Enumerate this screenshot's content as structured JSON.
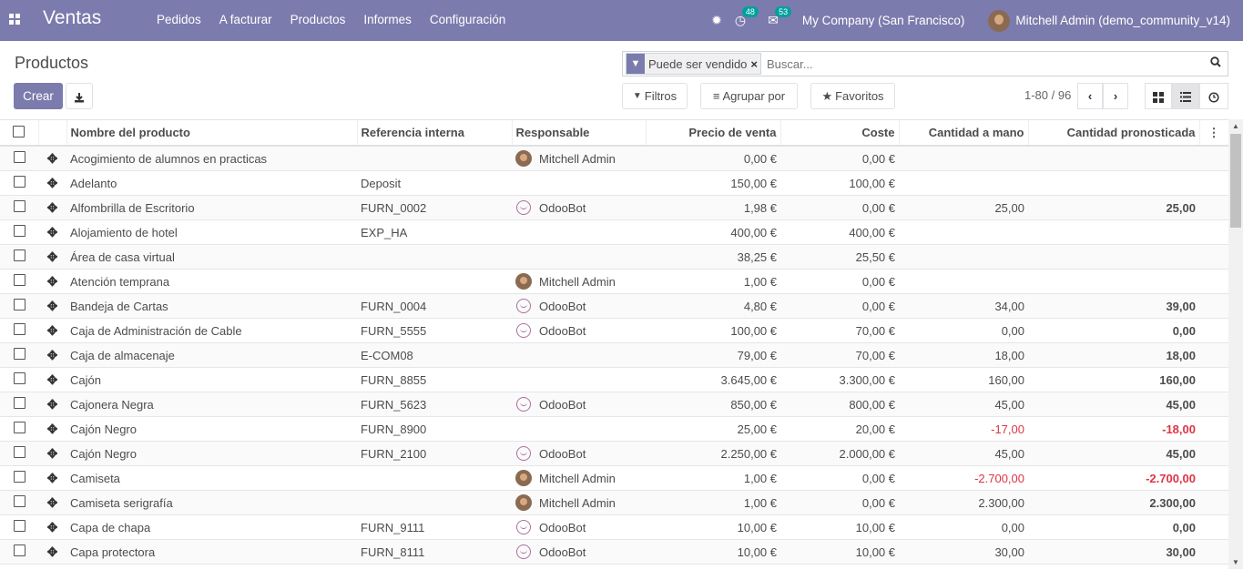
{
  "app": {
    "title": "Ventas",
    "menu": [
      "Pedidos",
      "A facturar",
      "Productos",
      "Informes",
      "Configuración"
    ],
    "activity_badge": "48",
    "messages_badge": "53",
    "company": "My Company (San Francisco)",
    "user": "Mitchell Admin (demo_community_v14)"
  },
  "control_panel": {
    "title": "Productos",
    "create_label": "Crear",
    "facet_label": "Puede ser vendido",
    "search_placeholder": "Buscar...",
    "filters_label": "Filtros",
    "group_by_label": "Agrupar por",
    "favorites_label": "Favoritos",
    "pager": "1-80 / 96"
  },
  "table": {
    "columns": [
      "Nombre del producto",
      "Referencia interna",
      "Responsable",
      "Precio de venta",
      "Coste",
      "Cantidad a mano",
      "Cantidad pronosticada"
    ],
    "rows": [
      {
        "name": "Acogimiento de alumnos en practicas",
        "ref": "",
        "resp": "Mitchell Admin",
        "resp_type": "mitchell",
        "price": "0,00 €",
        "cost": "0,00 €",
        "onhand": "",
        "forecast": "",
        "negative": false
      },
      {
        "name": "Adelanto",
        "ref": "Deposit",
        "resp": "",
        "resp_type": "",
        "price": "150,00 €",
        "cost": "100,00 €",
        "onhand": "",
        "forecast": "",
        "negative": false
      },
      {
        "name": "Alfombrilla de Escritorio",
        "ref": "FURN_0002",
        "resp": "OdooBot",
        "resp_type": "odoobot",
        "price": "1,98 €",
        "cost": "0,00 €",
        "onhand": "25,00",
        "forecast": "25,00",
        "negative": false
      },
      {
        "name": "Alojamiento de hotel",
        "ref": "EXP_HA",
        "resp": "",
        "resp_type": "",
        "price": "400,00 €",
        "cost": "400,00 €",
        "onhand": "",
        "forecast": "",
        "negative": false
      },
      {
        "name": "Área de casa virtual",
        "ref": "",
        "resp": "",
        "resp_type": "",
        "price": "38,25 €",
        "cost": "25,50 €",
        "onhand": "",
        "forecast": "",
        "negative": false
      },
      {
        "name": "Atención temprana",
        "ref": "",
        "resp": "Mitchell Admin",
        "resp_type": "mitchell",
        "price": "1,00 €",
        "cost": "0,00 €",
        "onhand": "",
        "forecast": "",
        "negative": false
      },
      {
        "name": "Bandeja de Cartas",
        "ref": "FURN_0004",
        "resp": "OdooBot",
        "resp_type": "odoobot",
        "price": "4,80 €",
        "cost": "0,00 €",
        "onhand": "34,00",
        "forecast": "39,00",
        "negative": false
      },
      {
        "name": "Caja de Administración de Cable",
        "ref": "FURN_5555",
        "resp": "OdooBot",
        "resp_type": "odoobot",
        "price": "100,00 €",
        "cost": "70,00 €",
        "onhand": "0,00",
        "forecast": "0,00",
        "negative": false
      },
      {
        "name": "Caja de almacenaje",
        "ref": "E-COM08",
        "resp": "",
        "resp_type": "",
        "price": "79,00 €",
        "cost": "70,00 €",
        "onhand": "18,00",
        "forecast": "18,00",
        "negative": false
      },
      {
        "name": "Cajón",
        "ref": "FURN_8855",
        "resp": "",
        "resp_type": "",
        "price": "3.645,00 €",
        "cost": "3.300,00 €",
        "onhand": "160,00",
        "forecast": "160,00",
        "negative": false
      },
      {
        "name": "Cajonera Negra",
        "ref": "FURN_5623",
        "resp": "OdooBot",
        "resp_type": "odoobot",
        "price": "850,00 €",
        "cost": "800,00 €",
        "onhand": "45,00",
        "forecast": "45,00",
        "negative": false
      },
      {
        "name": "Cajón Negro",
        "ref": "FURN_8900",
        "resp": "",
        "resp_type": "",
        "price": "25,00 €",
        "cost": "20,00 €",
        "onhand": "-17,00",
        "forecast": "-18,00",
        "negative": true
      },
      {
        "name": "Cajón Negro",
        "ref": "FURN_2100",
        "resp": "OdooBot",
        "resp_type": "odoobot",
        "price": "2.250,00 €",
        "cost": "2.000,00 €",
        "onhand": "45,00",
        "forecast": "45,00",
        "negative": false
      },
      {
        "name": "Camiseta",
        "ref": "",
        "resp": "Mitchell Admin",
        "resp_type": "mitchell",
        "price": "1,00 €",
        "cost": "0,00 €",
        "onhand": "-2.700,00",
        "forecast": "-2.700,00",
        "negative": true
      },
      {
        "name": "Camiseta serigrafía",
        "ref": "",
        "resp": "Mitchell Admin",
        "resp_type": "mitchell",
        "price": "1,00 €",
        "cost": "0,00 €",
        "onhand": "2.300,00",
        "forecast": "2.300,00",
        "negative": false
      },
      {
        "name": "Capa de chapa",
        "ref": "FURN_9111",
        "resp": "OdooBot",
        "resp_type": "odoobot",
        "price": "10,00 €",
        "cost": "10,00 €",
        "onhand": "0,00",
        "forecast": "0,00",
        "negative": false
      },
      {
        "name": "Capa protectora",
        "ref": "FURN_8111",
        "resp": "OdooBot",
        "resp_type": "odoobot",
        "price": "10,00 €",
        "cost": "10,00 €",
        "onhand": "30,00",
        "forecast": "30,00",
        "negative": false
      }
    ]
  }
}
